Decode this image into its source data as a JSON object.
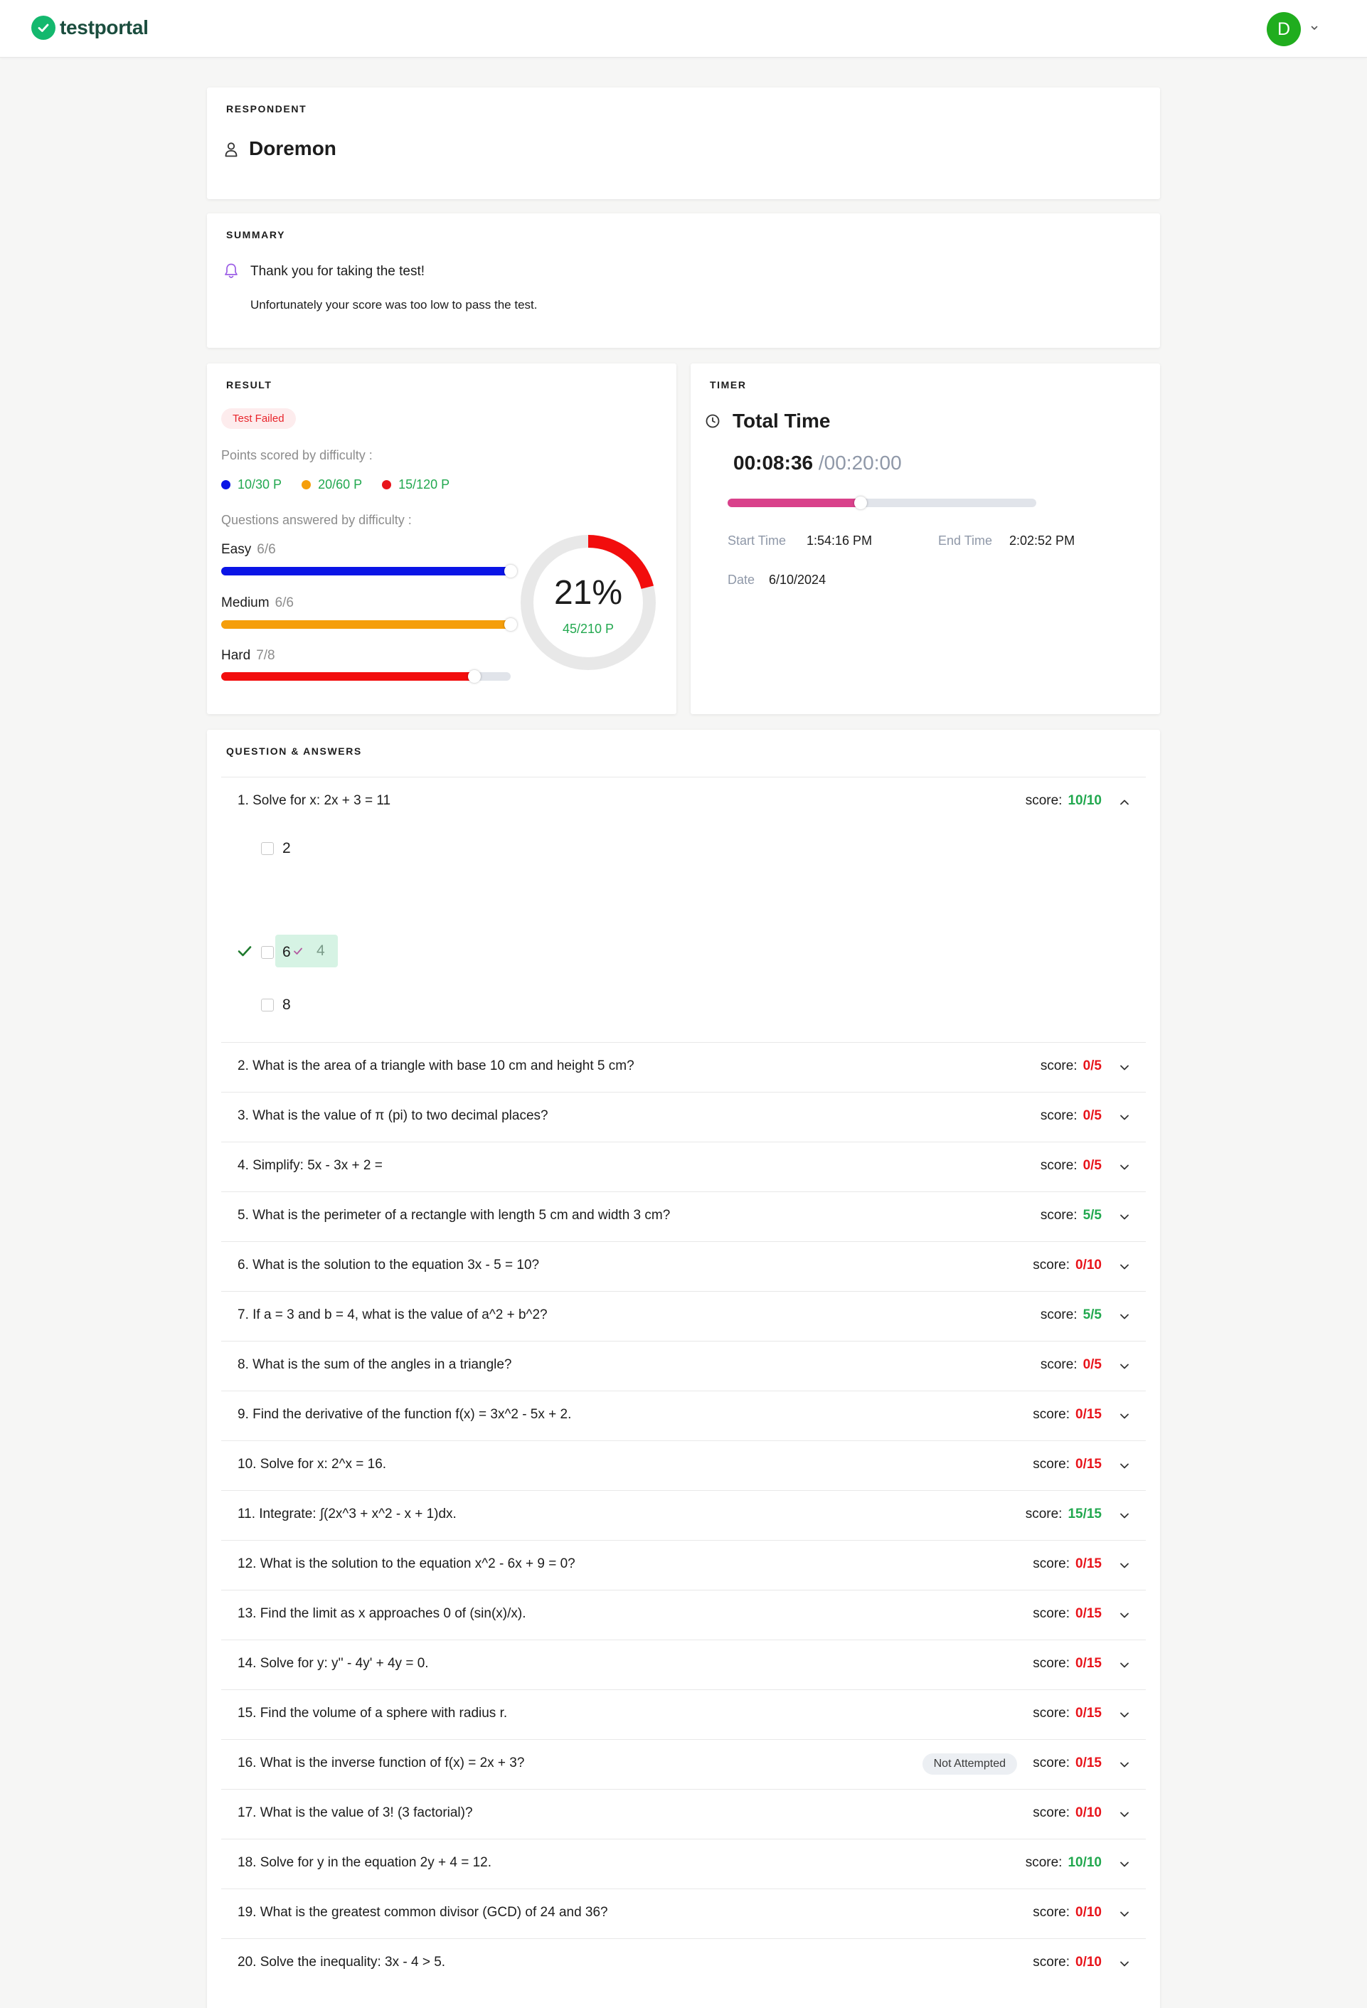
{
  "header": {
    "logo_text": "testportal",
    "avatar_initial": "D"
  },
  "respondent": {
    "label": "RESPONDENT",
    "name": "Doremon"
  },
  "summary": {
    "label": "SUMMARY",
    "thanks": "Thank you for taking the test!",
    "message": "Unfortunately your score was too low to pass the test."
  },
  "result": {
    "label": "RESULT",
    "status_badge": "Test Failed",
    "points_label": "Points scored by difficulty :",
    "points": [
      {
        "text": "10/30 P",
        "color": "#0a14e6"
      },
      {
        "text": "20/60 P",
        "color": "#f59e0b"
      },
      {
        "text": "15/120 P",
        "color": "#e8141b"
      }
    ],
    "questions_label": "Questions answered by difficulty :",
    "difficulties": [
      {
        "name": "Easy",
        "count": "6/6",
        "fraction": 1.0,
        "color": "#0a14e6"
      },
      {
        "name": "Medium",
        "count": "6/6",
        "fraction": 1.0,
        "color": "#f59e0b"
      },
      {
        "name": "Hard",
        "count": "7/8",
        "fraction": 0.875,
        "color": "#f20d0d"
      }
    ],
    "percent_text": "21%",
    "percent_value": 21,
    "total_points": "45/210 P",
    "donut_color": "#f20d0d"
  },
  "timer": {
    "label": "TIMER",
    "title": "Total Time",
    "elapsed": "00:08:36",
    "total": "/00:20:00",
    "progress_fraction": 0.43,
    "start_label": "Start Time",
    "start_value": "1:54:16 PM",
    "end_label": "End Time",
    "end_value": "2:02:52 PM",
    "date_label": "Date",
    "date_value": "6/10/2024"
  },
  "qa": {
    "label": "QUESTION & ANSWERS",
    "score_label": "score:",
    "not_attempted_label": "Not Attempted",
    "expanded_options": [
      "2",
      "4",
      "6",
      "8"
    ],
    "correct_option_index": 1,
    "questions": [
      {
        "text": "1. Solve for x: 2x + 3 = 11",
        "score": "10/10",
        "passed": true
      },
      {
        "text": "2. What is the area of a triangle with base 10 cm and height 5 cm?",
        "score": "0/5",
        "passed": false
      },
      {
        "text": "3. What is the value of π (pi) to two decimal places?",
        "score": "0/5",
        "passed": false
      },
      {
        "text": "4. Simplify: 5x - 3x + 2 =",
        "score": "0/5",
        "passed": false
      },
      {
        "text": "5. What is the perimeter of a rectangle with length 5 cm and width 3 cm?",
        "score": "5/5",
        "passed": true
      },
      {
        "text": "6. What is the solution to the equation 3x - 5 = 10?",
        "score": "0/10",
        "passed": false
      },
      {
        "text": "7. If a = 3 and b = 4, what is the value of a^2 + b^2?",
        "score": "5/5",
        "passed": true
      },
      {
        "text": "8. What is the sum of the angles in a triangle?",
        "score": "0/5",
        "passed": false
      },
      {
        "text": "9. Find the derivative of the function f(x) = 3x^2 - 5x + 2.",
        "score": "0/15",
        "passed": false
      },
      {
        "text": "10. Solve for x: 2^x = 16.",
        "score": "0/15",
        "passed": false
      },
      {
        "text": "11. Integrate: ∫(2x^3 + x^2 - x + 1)dx.",
        "score": "15/15",
        "passed": true
      },
      {
        "text": "12. What is the solution to the equation x^2 - 6x + 9 = 0?",
        "score": "0/15",
        "passed": false
      },
      {
        "text": "13. Find the limit as x approaches 0 of (sin(x)/x).",
        "score": "0/15",
        "passed": false
      },
      {
        "text": "14. Solve for y: y'' - 4y' + 4y = 0.",
        "score": "0/15",
        "passed": false
      },
      {
        "text": "15. Find the volume of a sphere with radius r.",
        "score": "0/15",
        "passed": false
      },
      {
        "text": "16. What is the inverse function of f(x) = 2x + 3?",
        "score": "0/15",
        "passed": false,
        "not_attempted": true
      },
      {
        "text": "17. What is the value of 3! (3 factorial)?",
        "score": "0/10",
        "passed": false
      },
      {
        "text": "18. Solve for y in the equation 2y + 4 = 12.",
        "score": "10/10",
        "passed": true
      },
      {
        "text": "19. What is the greatest common divisor (GCD) of 24 and 36?",
        "score": "0/10",
        "passed": false
      },
      {
        "text": "20. Solve the inequality: 3x - 4 > 5.",
        "score": "0/10",
        "passed": false
      }
    ]
  },
  "colors": {
    "pass": "#22a84f",
    "fail": "#e8141b",
    "brand": "#14b86e"
  }
}
